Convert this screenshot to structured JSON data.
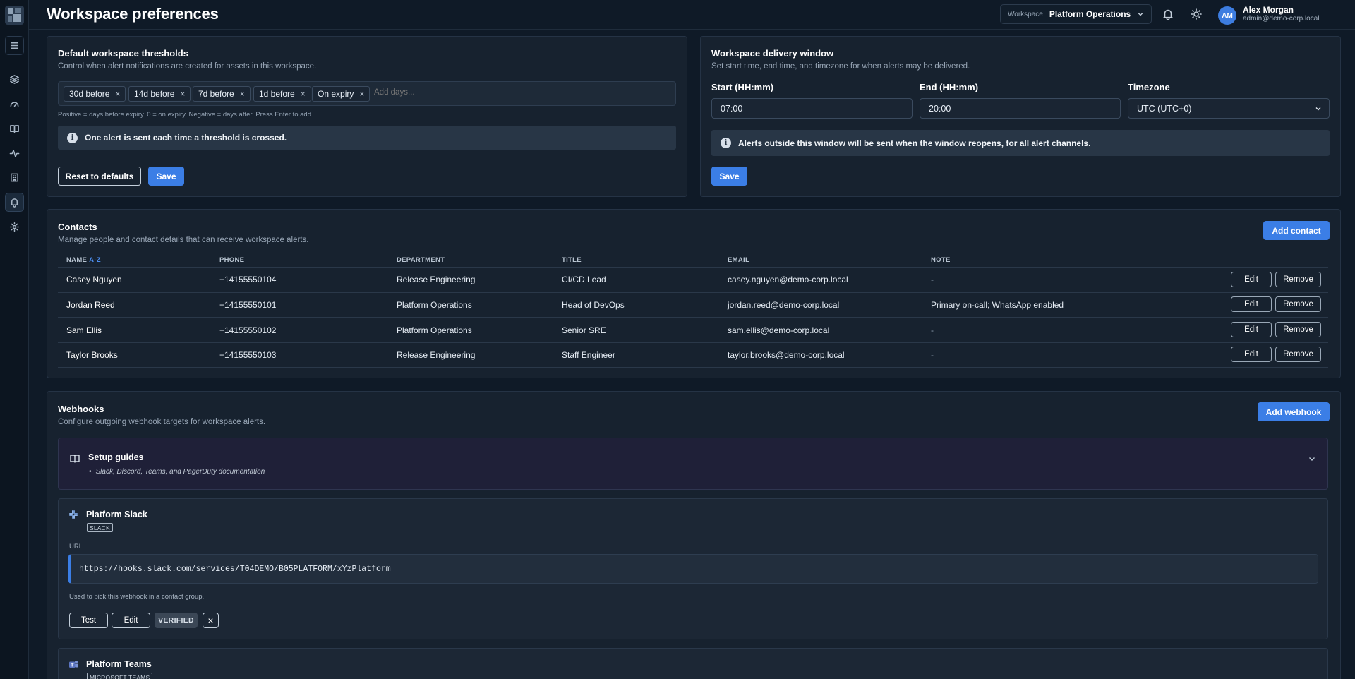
{
  "header": {
    "title": "Workspace preferences",
    "workspace_label": "Workspace",
    "workspace_value": "Platform Operations",
    "user_initials": "AM",
    "user_name": "Alex Morgan",
    "user_email": "admin@demo-corp.local"
  },
  "sidebar": {
    "icons": [
      "menu-icon",
      "layers-icon",
      "gauge-icon",
      "book-icon",
      "activity-icon",
      "building-icon",
      "bell-icon",
      "gear-icon"
    ],
    "active": "bell-icon"
  },
  "thresholds": {
    "title": "Default workspace thresholds",
    "subtitle": "Control when alert notifications are created for assets in this workspace.",
    "chips": [
      "30d before",
      "14d before",
      "7d before",
      "1d before",
      "On expiry"
    ],
    "chip_remove": "×",
    "input_placeholder": "Add days...",
    "hint": "Positive = days before expiry. 0 = on expiry. Negative = days after. Press Enter to add.",
    "info": "One alert is sent each time a threshold is crossed.",
    "reset_label": "Reset to defaults",
    "save_label": "Save"
  },
  "delivery": {
    "title": "Workspace delivery window",
    "subtitle": "Set start time, end time, and timezone for when alerts may be delivered.",
    "start_label": "Start (HH:mm)",
    "start_value": "07:00",
    "end_label": "End (HH:mm)",
    "end_value": "20:00",
    "tz_label": "Timezone",
    "tz_value": "UTC (UTC+0)",
    "info": "Alerts outside this window will be sent when the window reopens, for all alert channels.",
    "save_label": "Save"
  },
  "contacts": {
    "title": "Contacts",
    "subtitle": "Manage people and contact details that can receive workspace alerts.",
    "add_label": "Add contact",
    "columns": {
      "name": "NAME",
      "sort": "A-Z",
      "phone": "PHONE",
      "department": "DEPARTMENT",
      "title": "TITLE",
      "email": "EMAIL",
      "note": "NOTE"
    },
    "edit_label": "Edit",
    "remove_label": "Remove",
    "rows": [
      {
        "name": "Casey Nguyen",
        "phone": "+14155550104",
        "department": "Release Engineering",
        "title": "CI/CD Lead",
        "email": "casey.nguyen@demo-corp.local",
        "note": "-"
      },
      {
        "name": "Jordan Reed",
        "phone": "+14155550101",
        "department": "Platform Operations",
        "title": "Head of DevOps",
        "email": "jordan.reed@demo-corp.local",
        "note": "Primary on-call; WhatsApp enabled"
      },
      {
        "name": "Sam Ellis",
        "phone": "+14155550102",
        "department": "Platform Operations",
        "title": "Senior SRE",
        "email": "sam.ellis@demo-corp.local",
        "note": "-"
      },
      {
        "name": "Taylor Brooks",
        "phone": "+14155550103",
        "department": "Release Engineering",
        "title": "Staff Engineer",
        "email": "taylor.brooks@demo-corp.local",
        "note": "-"
      }
    ]
  },
  "webhooks": {
    "title": "Webhooks",
    "subtitle": "Configure outgoing webhook targets for workspace alerts.",
    "add_label": "Add webhook",
    "guides_title": "Setup guides",
    "guides_item": "Slack, Discord, Teams, and PagerDuty documentation",
    "hooks": [
      {
        "name": "Platform Slack",
        "type": "SLACK",
        "url_label": "URL",
        "url": "https://hooks.slack.com/services/T04DEMO/B05PLATFORM/xYzPlatform",
        "help": "Used to pick this webhook in a contact group.",
        "test_label": "Test",
        "edit_label": "Edit",
        "status": "VERIFIED",
        "remove_icon": "×"
      },
      {
        "name": "Platform Teams",
        "type": "MICROSOFT TEAMS"
      }
    ]
  },
  "colors": {
    "background": "#0f1a27",
    "panel": "#17222f",
    "accent": "#3b7ee6",
    "text": "#e6edf5"
  }
}
